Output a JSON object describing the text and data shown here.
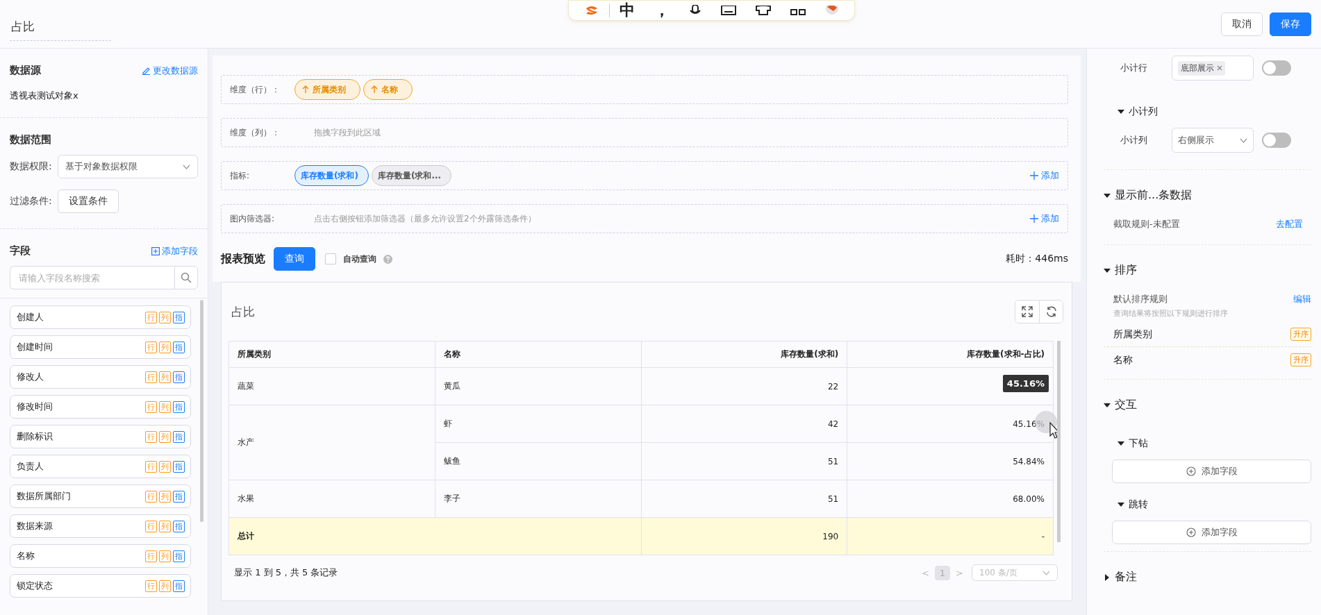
{
  "header": {
    "title": "占比",
    "buttons": [
      {
        "label": "取消",
        "kind": "default"
      },
      {
        "label": "保存",
        "kind": "primary"
      }
    ]
  },
  "ime_toolbar": {
    "keys": [
      {
        "kind": "logo"
      },
      {
        "kind": "text",
        "label": "中"
      },
      {
        "kind": "text",
        "label": "，"
      },
      {
        "kind": "mic"
      },
      {
        "kind": "keyboard"
      },
      {
        "kind": "shirt"
      },
      {
        "kind": "grid"
      },
      {
        "kind": "avatar"
      }
    ]
  },
  "sidebar": {
    "datasource": {
      "title": "数据源",
      "link": "更改数据源",
      "value": "透视表测试对象x"
    },
    "range": {
      "title": "数据范围",
      "permission_label": "数据权限:",
      "permission_value": "基于对象数据权限",
      "filter_label": "过滤条件:",
      "filter_button": "设置条件"
    },
    "fields": {
      "title": "字段",
      "link": "添加字段",
      "search_placeholder": "请输入字段名称搜索",
      "items": [
        {
          "name": "创建人",
          "tags": [
            {
              "label": "行",
              "color": "#ff9a1f"
            },
            {
              "label": "列",
              "color": "#ff9a1f"
            },
            {
              "label": "指",
              "color": "#1a7dff"
            }
          ]
        },
        {
          "name": "创建时间",
          "tags": [
            {
              "label": "行",
              "color": "#ff9a1f"
            },
            {
              "label": "列",
              "color": "#ff9a1f"
            },
            {
              "label": "指",
              "color": "#1a7dff"
            }
          ]
        },
        {
          "name": "修改人",
          "tags": [
            {
              "label": "行",
              "color": "#ff9a1f"
            },
            {
              "label": "列",
              "color": "#ff9a1f"
            },
            {
              "label": "指",
              "color": "#1a7dff"
            }
          ]
        },
        {
          "name": "修改时间",
          "tags": [
            {
              "label": "行",
              "color": "#ff9a1f"
            },
            {
              "label": "列",
              "color": "#ff9a1f"
            },
            {
              "label": "指",
              "color": "#1a7dff"
            }
          ]
        },
        {
          "name": "删除标识",
          "tags": [
            {
              "label": "行",
              "color": "#ff9a1f"
            },
            {
              "label": "列",
              "color": "#ff9a1f"
            },
            {
              "label": "指",
              "color": "#1a7dff"
            }
          ]
        },
        {
          "name": "负责人",
          "tags": [
            {
              "label": "行",
              "color": "#ff9a1f"
            },
            {
              "label": "列",
              "color": "#ff9a1f"
            },
            {
              "label": "指",
              "color": "#1a7dff"
            }
          ]
        },
        {
          "name": "数据所属部门",
          "tags": [
            {
              "label": "行",
              "color": "#ff9a1f"
            },
            {
              "label": "列",
              "color": "#ff9a1f"
            },
            {
              "label": "指",
              "color": "#1a7dff"
            }
          ]
        },
        {
          "name": "数据来源",
          "tags": [
            {
              "label": "行",
              "color": "#ff9a1f"
            },
            {
              "label": "列",
              "color": "#ff9a1f"
            },
            {
              "label": "指",
              "color": "#1a7dff"
            }
          ]
        },
        {
          "name": "名称",
          "tags": [
            {
              "label": "行",
              "color": "#ff9a1f"
            },
            {
              "label": "列",
              "color": "#ff9a1f"
            },
            {
              "label": "指",
              "color": "#1a7dff"
            }
          ]
        },
        {
          "name": "锁定状态",
          "tags": [
            {
              "label": "行",
              "color": "#ff9a1f"
            },
            {
              "label": "列",
              "color": "#ff9a1f"
            },
            {
              "label": "指",
              "color": "#1a7dff"
            }
          ]
        }
      ]
    }
  },
  "config": {
    "zones": [
      {
        "label": "维度（行）：",
        "kind": "row",
        "chips": [
          {
            "label": "所属类别"
          },
          {
            "label": "名称"
          }
        ]
      },
      {
        "label": "维度（列）：",
        "kind": "col",
        "placeholder": "拖拽字段到此区域"
      },
      {
        "label": "指标:",
        "kind": "metric",
        "chips": [
          {
            "label": "库存数量(求和)",
            "selected": true
          },
          {
            "label": "库存数量(求和...",
            "selected": false
          }
        ],
        "action": "添加"
      },
      {
        "label": "图内筛选器:",
        "kind": "filter",
        "placeholder": "点击右侧按钮添加筛选器（最多允许设置2个外露筛选条件）",
        "action": "添加"
      }
    ]
  },
  "preview": {
    "title": "报表预览",
    "query_button": "查询",
    "auto_query": {
      "label": "自动查询",
      "checked": false
    },
    "elapsed": "耗时：446ms"
  },
  "report": {
    "title": "占比",
    "table": {
      "columns": [
        "所属类别",
        "名称",
        "库存数量(求和)",
        "库存数量(求和-占比)"
      ],
      "groups": [
        {
          "category": "蔬菜",
          "rows": [
            {
              "name": "黄瓜",
              "sum": "22",
              "ratio": null
            }
          ]
        },
        {
          "category": "水产",
          "rows": [
            {
              "name": "虾",
              "sum": "42",
              "ratio": "45.16%"
            },
            {
              "name": "鲅鱼",
              "sum": "51",
              "ratio": "54.84%"
            }
          ]
        },
        {
          "category": "水果",
          "rows": [
            {
              "name": "李子",
              "sum": "51",
              "ratio": "68.00%"
            }
          ]
        }
      ],
      "total": {
        "label": "总计",
        "sum": "190",
        "ratio": "-"
      }
    },
    "tooltip": "45.16%",
    "footer": {
      "summary": "显示 1 到 5，共 5 条记录",
      "prev": "<",
      "page": "1",
      "next": ">",
      "page_size": "100 条/页"
    }
  },
  "settings": {
    "subtotal_row": {
      "label": "小计行",
      "tag": "底部展示",
      "on": false
    },
    "subtotal_col_section": {
      "title": "小计列",
      "expanded": true,
      "label": "小计列",
      "value": "右侧展示",
      "on": false
    },
    "top_n": {
      "title": "显示前...条数据",
      "expanded": true,
      "rule": "截取规则-未配置",
      "link": "去配置"
    },
    "sort": {
      "title": "排序",
      "expanded": true,
      "rule_title": "默认排序规则",
      "link": "编辑",
      "hint": "查询结果将按照以下规则进行排序",
      "items": [
        {
          "name": "所属类别",
          "order": "升序"
        },
        {
          "name": "名称",
          "order": "升序"
        }
      ]
    },
    "interaction": {
      "title": "交互",
      "expanded": true,
      "subsections": [
        {
          "title": "下钻",
          "expanded": true,
          "button": "添加字段"
        },
        {
          "title": "跳转",
          "expanded": true,
          "button": "添加字段"
        }
      ]
    },
    "notes": {
      "title": "备注",
      "expanded": false
    }
  }
}
